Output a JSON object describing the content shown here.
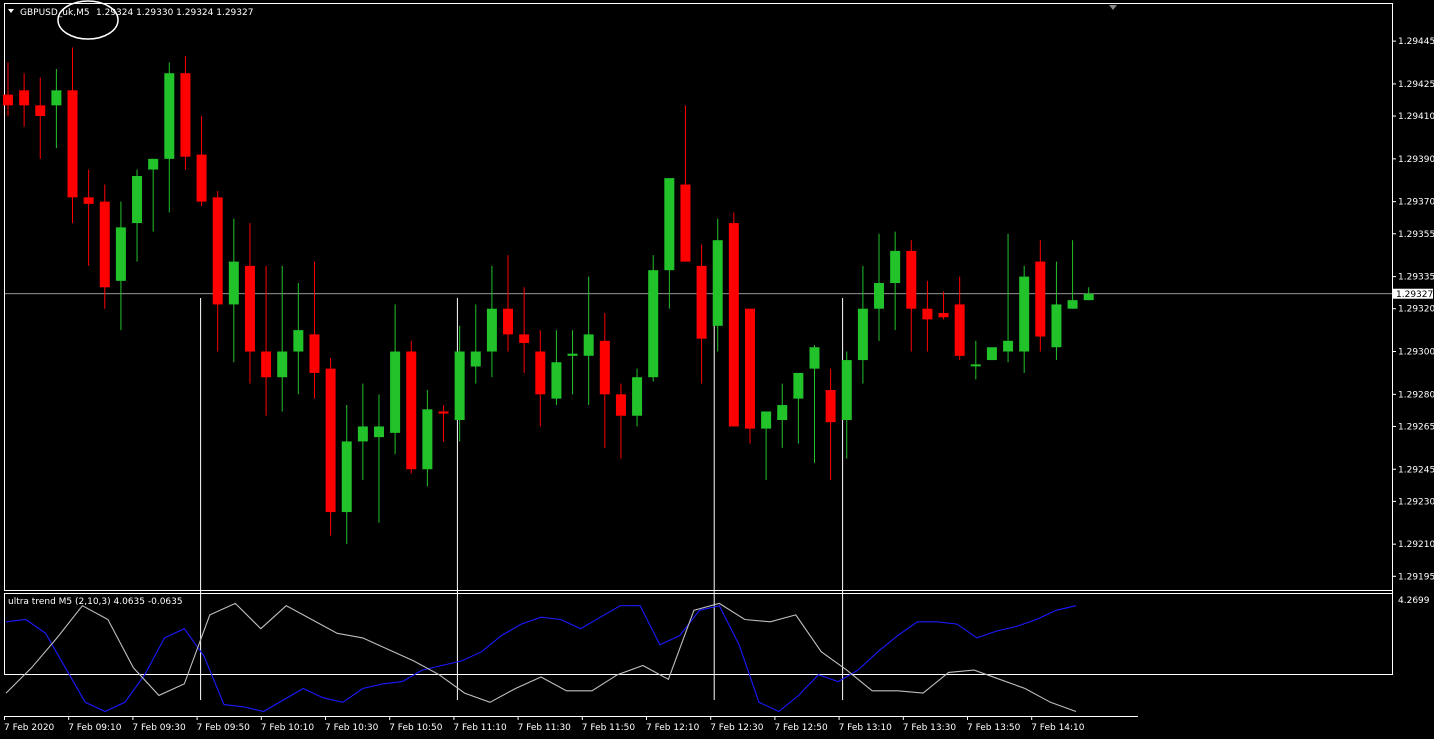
{
  "colors": {
    "background": "#000000",
    "bull": "#22c22a",
    "bear": "#ff0000",
    "frame": "#ffffff",
    "price_line": "#c8c8c8",
    "indicator_blue": "#1a1aff",
    "indicator_gray": "#bfbfbf",
    "annotation_circle": "#ffffff"
  },
  "header": {
    "dropdown_icon": "triangle-down-icon",
    "symbol_timeframe": "GBPUSD_uk,M5",
    "ohlc": "1.29324 1.29330 1.29324 1.29327"
  },
  "indicator_header": "ultra trend M5 (2,10,3) 4.0635 -0.0635",
  "indicator_max_label": "4.2699",
  "current_price_label": "1.29327",
  "chart_data": [
    {
      "type": "candlestick",
      "symbol": "GBPUSD_uk",
      "timeframe": "M5",
      "ylim": [
        1.2919,
        1.2946
      ],
      "y_ticks": [
        "1.29445",
        "1.29425",
        "1.29410",
        "1.29390",
        "1.29370",
        "1.29355",
        "1.29335",
        "1.29320",
        "1.29300",
        "1.29280",
        "1.29265",
        "1.29245",
        "1.29230",
        "1.29210",
        "1.29195"
      ],
      "y_tick_values": [
        1.29445,
        1.29425,
        1.2941,
        1.2939,
        1.2937,
        1.29355,
        1.29335,
        1.2932,
        1.293,
        1.2928,
        1.29265,
        1.29245,
        1.2923,
        1.2921,
        1.29195
      ],
      "current_price": 1.29327,
      "candles": [
        [
          1.2942,
          1.29435,
          1.2941,
          1.29415
        ],
        [
          1.29422,
          1.2943,
          1.29405,
          1.29415
        ],
        [
          1.29415,
          1.29428,
          1.2939,
          1.2941
        ],
        [
          1.29415,
          1.29432,
          1.29395,
          1.29422
        ],
        [
          1.29422,
          1.29442,
          1.2936,
          1.29372
        ],
        [
          1.29372,
          1.29385,
          1.2934,
          1.29369
        ],
        [
          1.2937,
          1.29378,
          1.2932,
          1.2933
        ],
        [
          1.29333,
          1.2937,
          1.2931,
          1.29358
        ],
        [
          1.2936,
          1.29385,
          1.29342,
          1.29382
        ],
        [
          1.29385,
          1.2939,
          1.29356,
          1.2939
        ],
        [
          1.2939,
          1.29435,
          1.29365,
          1.2943
        ],
        [
          1.2943,
          1.29438,
          1.29385,
          1.29391
        ],
        [
          1.29392,
          1.2941,
          1.29368,
          1.2937
        ],
        [
          1.29372,
          1.29375,
          1.293,
          1.29322
        ],
        [
          1.29322,
          1.29362,
          1.29295,
          1.29342
        ],
        [
          1.2934,
          1.2936,
          1.29285,
          1.293
        ],
        [
          1.293,
          1.2934,
          1.2927,
          1.29288
        ],
        [
          1.29288,
          1.2934,
          1.29272,
          1.293
        ],
        [
          1.293,
          1.29332,
          1.2928,
          1.2931
        ],
        [
          1.29308,
          1.29342,
          1.29278,
          1.2929
        ],
        [
          1.29292,
          1.29297,
          1.29214,
          1.29225
        ],
        [
          1.29225,
          1.29275,
          1.2921,
          1.29258
        ],
        [
          1.29258,
          1.29285,
          1.2924,
          1.29265
        ],
        [
          1.2926,
          1.2928,
          1.2922,
          1.29265
        ],
        [
          1.29262,
          1.29322,
          1.29252,
          1.293
        ],
        [
          1.293,
          1.29305,
          1.29243,
          1.29245
        ],
        [
          1.29245,
          1.29282,
          1.29237,
          1.29273
        ],
        [
          1.29272,
          1.29275,
          1.29258,
          1.29271
        ],
        [
          1.29268,
          1.29312,
          1.29258,
          1.293
        ],
        [
          1.29293,
          1.29322,
          1.29285,
          1.293
        ],
        [
          1.293,
          1.2934,
          1.29288,
          1.2932
        ],
        [
          1.2932,
          1.29345,
          1.293,
          1.29308
        ],
        [
          1.29308,
          1.2933,
          1.2929,
          1.29304
        ],
        [
          1.293,
          1.2931,
          1.29265,
          1.2928
        ],
        [
          1.29278,
          1.2931,
          1.29275,
          1.29295
        ],
        [
          1.29298,
          1.2931,
          1.2928,
          1.29299
        ],
        [
          1.29298,
          1.29335,
          1.29275,
          1.29308
        ],
        [
          1.29305,
          1.29318,
          1.29255,
          1.2928
        ],
        [
          1.2928,
          1.29285,
          1.2925,
          1.2927
        ],
        [
          1.2927,
          1.29292,
          1.29265,
          1.29288
        ],
        [
          1.29288,
          1.29345,
          1.29286,
          1.29338
        ],
        [
          1.29338,
          1.29372,
          1.2932,
          1.29381
        ],
        [
          1.29378,
          1.29415,
          1.29345,
          1.29342
        ],
        [
          1.2934,
          1.2935,
          1.29285,
          1.29306
        ],
        [
          1.29312,
          1.29362,
          1.293,
          1.29352
        ],
        [
          1.2936,
          1.29365,
          1.293,
          1.29265
        ],
        [
          1.2932,
          1.2932,
          1.29257,
          1.29264
        ],
        [
          1.29264,
          1.2927,
          1.2924,
          1.29272
        ],
        [
          1.29268,
          1.29285,
          1.29255,
          1.29275
        ],
        [
          1.29278,
          1.2929,
          1.29257,
          1.2929
        ],
        [
          1.29292,
          1.29303,
          1.29248,
          1.29302
        ],
        [
          1.29282,
          1.29292,
          1.2924,
          1.29267
        ],
        [
          1.29268,
          1.293,
          1.2925,
          1.29296
        ],
        [
          1.29296,
          1.2934,
          1.29285,
          1.2932
        ],
        [
          1.2932,
          1.29355,
          1.29305,
          1.29332
        ],
        [
          1.29332,
          1.29356,
          1.2931,
          1.29347
        ],
        [
          1.29347,
          1.29352,
          1.293,
          1.2932
        ],
        [
          1.2932,
          1.29333,
          1.293,
          1.29315
        ],
        [
          1.29318,
          1.29328,
          1.29315,
          1.29316
        ],
        [
          1.29322,
          1.29335,
          1.29296,
          1.29298
        ],
        [
          1.29294,
          1.29305,
          1.29287,
          1.29294
        ],
        [
          1.29296,
          1.293,
          1.29297,
          1.29302
        ],
        [
          1.293,
          1.29355,
          1.29295,
          1.29305
        ],
        [
          1.293,
          1.2934,
          1.2929,
          1.29335
        ],
        [
          1.29342,
          1.29352,
          1.293,
          1.29307
        ],
        [
          1.29302,
          1.29342,
          1.29296,
          1.29322
        ],
        [
          1.2932,
          1.29352,
          1.2932,
          1.29324
        ],
        [
          1.29324,
          1.2933,
          1.29324,
          1.29327
        ]
      ]
    },
    {
      "type": "line",
      "name": "ultra trend M5 (2,10,3)",
      "current_values": [
        4.0635,
        -0.0635
      ],
      "ylim": [
        -0.42,
        4.45
      ],
      "y_ticks": [
        "4.2699"
      ],
      "y_tick_values": [
        4.2699
      ],
      "series": [
        {
          "color": "#1a1aff",
          "values": [
            3.5,
            3.6,
            3.0,
            1.5,
            0.0,
            -0.4,
            0.0,
            1.2,
            2.8,
            3.2,
            2.0,
            -0.1,
            -0.2,
            -0.4,
            0.1,
            0.6,
            0.2,
            0.0,
            0.6,
            0.8,
            0.9,
            1.4,
            1.6,
            1.8,
            2.2,
            2.9,
            3.4,
            3.7,
            3.6,
            3.2,
            3.7,
            4.2,
            4.2,
            2.5,
            2.9,
            4.0,
            4.2,
            2.5,
            0.0,
            -0.4,
            0.3,
            1.2,
            0.9,
            1.4,
            2.2,
            2.9,
            3.5,
            3.5,
            3.4,
            2.8,
            3.1,
            3.3,
            3.6,
            4.0,
            4.2
          ]
        },
        {
          "color": "#bfbfbf",
          "values": [
            0.4,
            1.5,
            2.8,
            4.2,
            3.6,
            1.5,
            0.3,
            0.8,
            3.8,
            4.3,
            3.2,
            4.2,
            3.6,
            3.0,
            2.8,
            2.3,
            1.8,
            1.2,
            0.4,
            0.0,
            0.6,
            1.1,
            0.5,
            0.5,
            1.2,
            1.6,
            1.0,
            4.0,
            4.3,
            3.6,
            3.5,
            3.8,
            2.2,
            1.4,
            0.5,
            0.5,
            0.4,
            1.3,
            1.4,
            1.0,
            0.6,
            0.0,
            -0.4
          ]
        }
      ]
    }
  ],
  "x_labels": [
    "7 Feb 2020",
    "7 Feb 09:10",
    "7 Feb 09:30",
    "7 Feb 09:50",
    "7 Feb 10:10",
    "7 Feb 10:30",
    "7 Feb 10:50",
    "7 Feb 11:10",
    "7 Feb 11:30",
    "7 Feb 11:50",
    "7 Feb 12:10",
    "7 Feb 12:30",
    "7 Feb 12:50",
    "7 Feb 13:10",
    "7 Feb 13:30",
    "7 Feb 13:50",
    "7 Feb 14:10"
  ],
  "vertical_markers": [
    "7 Feb 09:50",
    "7 Feb 11:10",
    "7 Feb 12:30",
    "7 Feb 13:10"
  ]
}
